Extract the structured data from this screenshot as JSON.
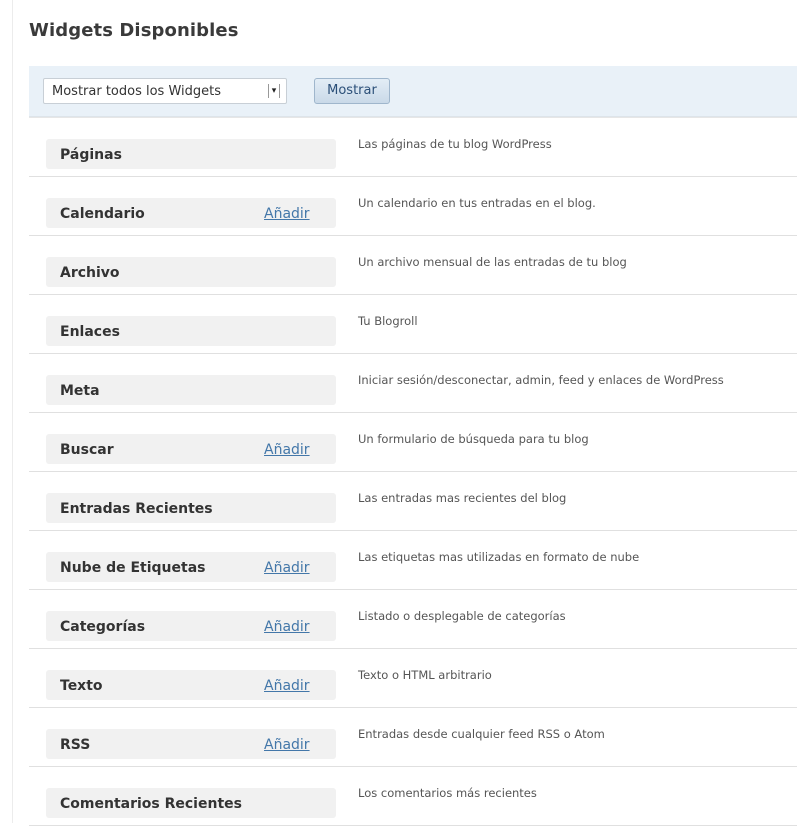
{
  "title": "Widgets Disponibles",
  "filter": {
    "select_value": "Mostrar todos los Widgets",
    "button_label": "Mostrar"
  },
  "widgets": [
    {
      "name": "Páginas",
      "add_label": "",
      "description": "Las páginas de tu blog WordPress"
    },
    {
      "name": "Calendario",
      "add_label": "Añadir",
      "description": "Un calendario en tus entradas en el blog."
    },
    {
      "name": "Archivo",
      "add_label": "",
      "description": "Un archivo mensual de las entradas de tu blog"
    },
    {
      "name": "Enlaces",
      "add_label": "",
      "description": "Tu Blogroll"
    },
    {
      "name": "Meta",
      "add_label": "",
      "description": "Iniciar sesión/desconectar, admin, feed y enlaces de WordPress"
    },
    {
      "name": "Buscar",
      "add_label": "Añadir",
      "description": "Un formulario de búsqueda para tu blog"
    },
    {
      "name": "Entradas Recientes",
      "add_label": "",
      "description": "Las entradas mas recientes del blog"
    },
    {
      "name": "Nube de Etiquetas",
      "add_label": "Añadir",
      "description": "Las etiquetas mas utilizadas en formato de nube"
    },
    {
      "name": "Categorías",
      "add_label": "Añadir",
      "description": "Listado o desplegable de categorías"
    },
    {
      "name": "Texto",
      "add_label": "Añadir",
      "description": "Texto o HTML arbitrario"
    },
    {
      "name": "RSS",
      "add_label": "Añadir",
      "description": "Entradas desde cualquier feed RSS o Atom"
    },
    {
      "name": "Comentarios Recientes",
      "add_label": "",
      "description": "Los comentarios más recientes"
    }
  ]
}
